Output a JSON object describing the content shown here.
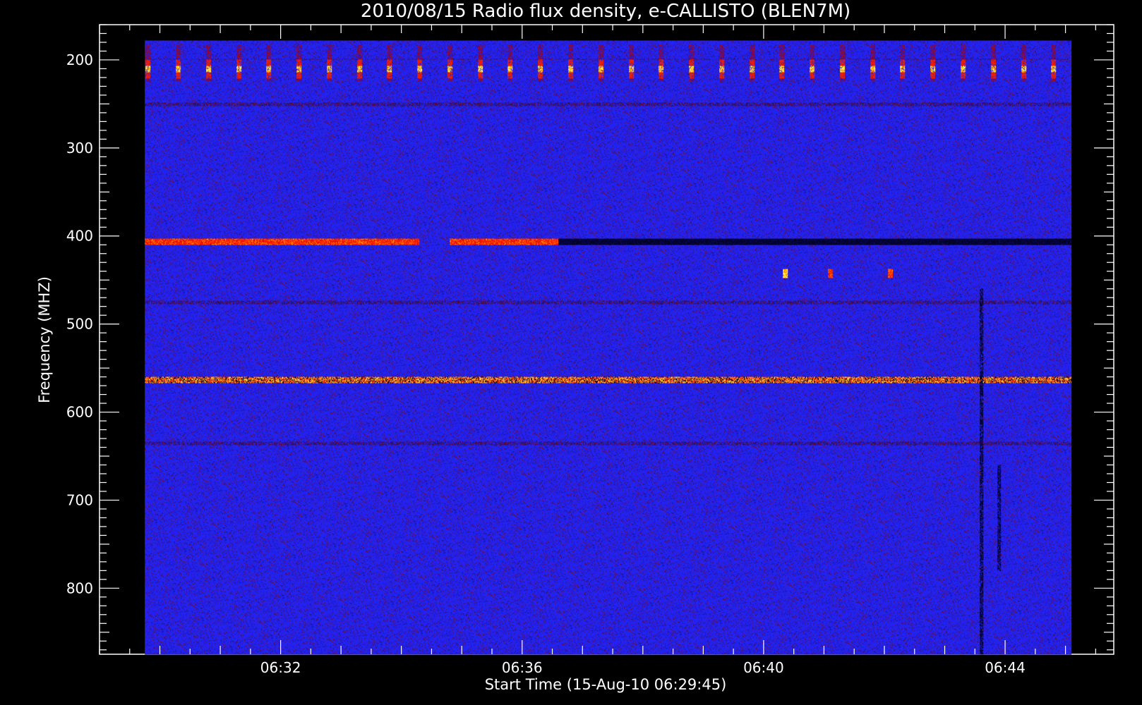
{
  "chart_data": {
    "type": "heatmap",
    "title": "2010/08/15  Radio flux density, e-CALLISTO (BLEN7M)",
    "xlabel": "Start Time (15-Aug-10 06:29:45)",
    "ylabel": "Frequency (MHZ)",
    "x_range_minutes": [
      29.0,
      45.8
    ],
    "data_x_range_minutes": [
      29.75,
      45.1
    ],
    "y_range_mhz": [
      160,
      875
    ],
    "data_y_range_mhz": [
      178,
      875
    ],
    "y_inverted": true,
    "x_ticks": [
      {
        "value": 32,
        "label": "06:32"
      },
      {
        "value": 36,
        "label": "06:36"
      },
      {
        "value": 40,
        "label": "06:40"
      },
      {
        "value": 44,
        "label": "06:44"
      }
    ],
    "y_ticks": [
      {
        "value": 200,
        "label": "200"
      },
      {
        "value": 300,
        "label": "300"
      },
      {
        "value": 400,
        "label": "400"
      },
      {
        "value": 500,
        "label": "500"
      },
      {
        "value": 600,
        "label": "600"
      },
      {
        "value": 700,
        "label": "700"
      },
      {
        "value": 800,
        "label": "800"
      }
    ],
    "grid": false,
    "legend": "none",
    "colormap": [
      "#000000",
      "#000060",
      "#1a1ae8",
      "#2222ee",
      "#7a0a30",
      "#cc0a0a",
      "#ff2a00",
      "#ff9a00",
      "#ffff60"
    ],
    "background_color": "#2020e6",
    "features": [
      {
        "kind": "band",
        "freq_mhz": 210,
        "from_min": 29.75,
        "to_min": 45.1,
        "intensity": "periodic-bursts",
        "period_min": 0.5
      },
      {
        "kind": "band",
        "freq_mhz": 406,
        "from_min": 29.75,
        "to_min": 34.3,
        "intensity": "strong"
      },
      {
        "kind": "band",
        "freq_mhz": 406,
        "from_min": 34.8,
        "to_min": 36.6,
        "intensity": "strong"
      },
      {
        "kind": "band",
        "freq_mhz": 406,
        "from_min": 36.6,
        "to_min": 45.1,
        "intensity": "dark"
      },
      {
        "kind": "band",
        "freq_mhz": 563,
        "from_min": 29.75,
        "to_min": 45.1,
        "intensity": "speckled-strong"
      },
      {
        "kind": "band",
        "freq_mhz": 250,
        "from_min": 29.75,
        "to_min": 45.1,
        "intensity": "weak"
      },
      {
        "kind": "band",
        "freq_mhz": 475,
        "from_min": 29.75,
        "to_min": 45.1,
        "intensity": "weak"
      },
      {
        "kind": "band",
        "freq_mhz": 635,
        "from_min": 29.75,
        "to_min": 45.1,
        "intensity": "weak"
      },
      {
        "kind": "spot",
        "freq_mhz": 442,
        "time_min": 40.35,
        "intensity": "hot"
      },
      {
        "kind": "spot",
        "freq_mhz": 442,
        "time_min": 41.1,
        "intensity": "strong"
      },
      {
        "kind": "spot",
        "freq_mhz": 442,
        "time_min": 42.1,
        "intensity": "strong"
      },
      {
        "kind": "vline",
        "time_min": 43.6,
        "from_mhz": 460,
        "to_mhz": 875,
        "intensity": "dark"
      },
      {
        "kind": "vline",
        "time_min": 43.9,
        "from_mhz": 660,
        "to_mhz": 780,
        "intensity": "dark"
      }
    ]
  }
}
